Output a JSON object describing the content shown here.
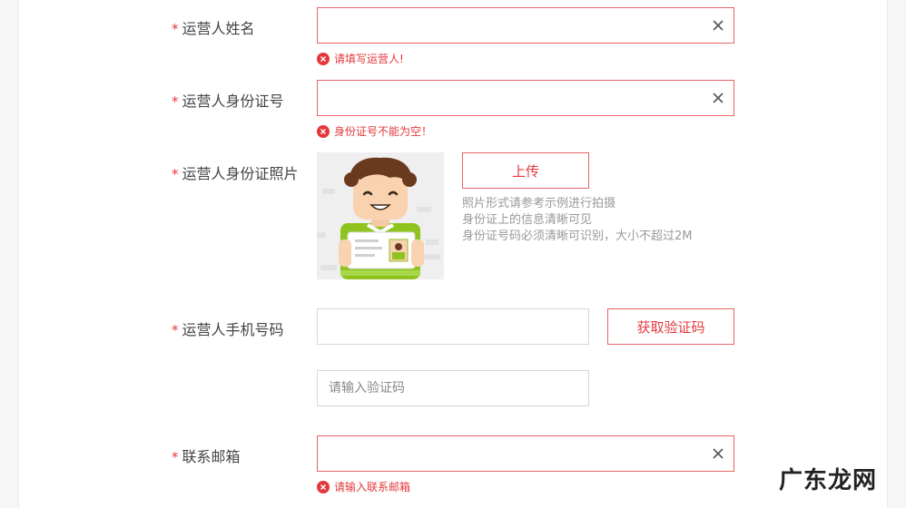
{
  "form": {
    "name": {
      "label": "运营人姓名",
      "value": "",
      "error": "请填写运营人!"
    },
    "id_number": {
      "label": "运营人身份证号",
      "value": "",
      "error": "身份证号不能为空！"
    },
    "id_photo": {
      "label": "运营人身份证照片",
      "upload_label": "上传",
      "hints": [
        "照片形式请参考示例进行拍摄",
        "身份证上的信息清晰可见",
        "身份证号码必须清晰可识别，大小不超过2M"
      ]
    },
    "phone": {
      "label": "运营人手机号码",
      "value": "",
      "get_code_label": "获取验证码",
      "code_placeholder": "请输入验证码"
    },
    "email": {
      "label": "联系邮箱",
      "value": "",
      "error": "请输入联系邮箱"
    }
  },
  "required_mark": "*",
  "watermark": "广东龙网",
  "colors": {
    "accent": "#e4393c",
    "error_border": "#e86464",
    "border": "#d6d6d6",
    "hint": "#999999"
  }
}
